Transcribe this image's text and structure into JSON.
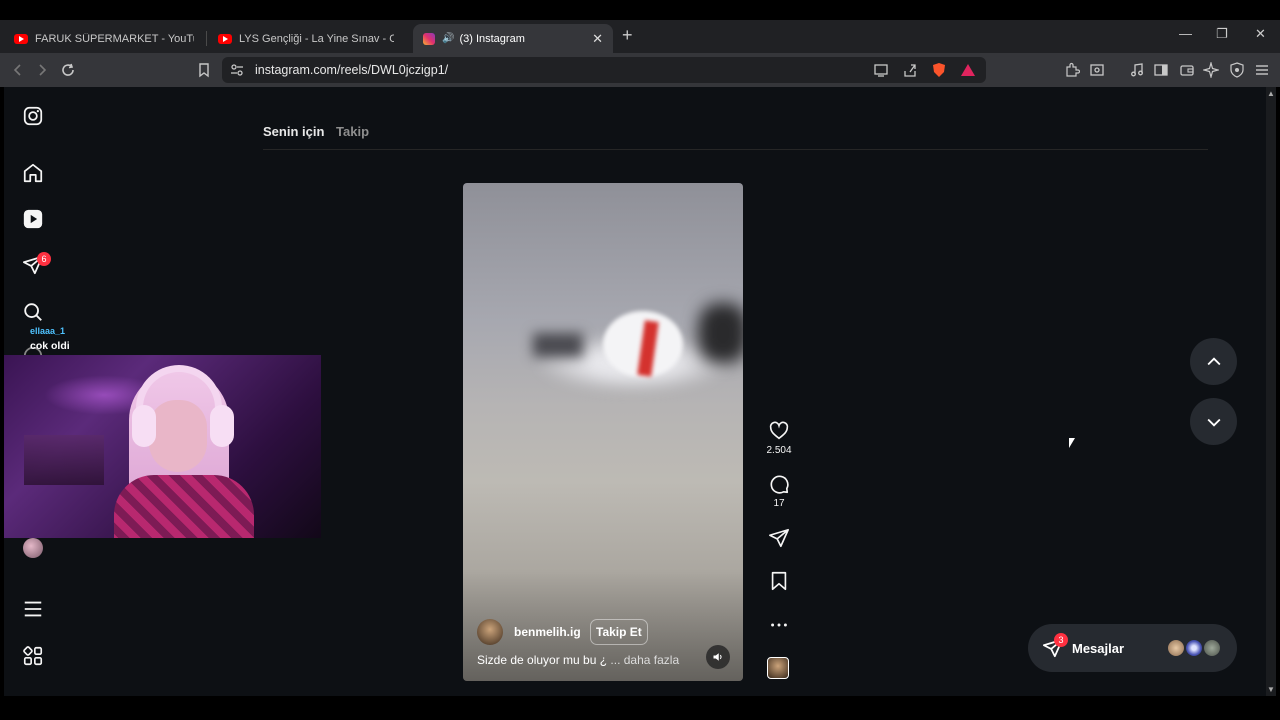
{
  "browser": {
    "tabs": [
      {
        "title": "FARUK SÜPERMARKET - YouTube",
        "favicon": "youtube-icon"
      },
      {
        "title": "LYS Gençliği - La Yine Sınav - Okuyorı",
        "favicon": "youtube-icon"
      },
      {
        "title": "(3) Instagram",
        "favicon": "instagram-icon",
        "active": true
      }
    ],
    "url": "instagram.com/reels/DWL0jczigp1/"
  },
  "sidebar": {
    "notification_count": "6",
    "chat_user": "ellaaa_1",
    "chat_message": "cok oldi"
  },
  "feed": {
    "tab_for_you": "Senin için",
    "tab_following": "Takip"
  },
  "reel": {
    "author": "benmelih.ig",
    "follow_label": "Takip Et",
    "caption": "Sizde de oluyor mu bu ¿",
    "more_label": "... daha fazla",
    "likes": "2.504",
    "comments": "17"
  },
  "messages": {
    "label": "Mesajlar",
    "badge": "3"
  },
  "colors": {
    "page_bg": "#0d1014",
    "badge_red": "#ff3040",
    "button_bg": "#262a30"
  }
}
